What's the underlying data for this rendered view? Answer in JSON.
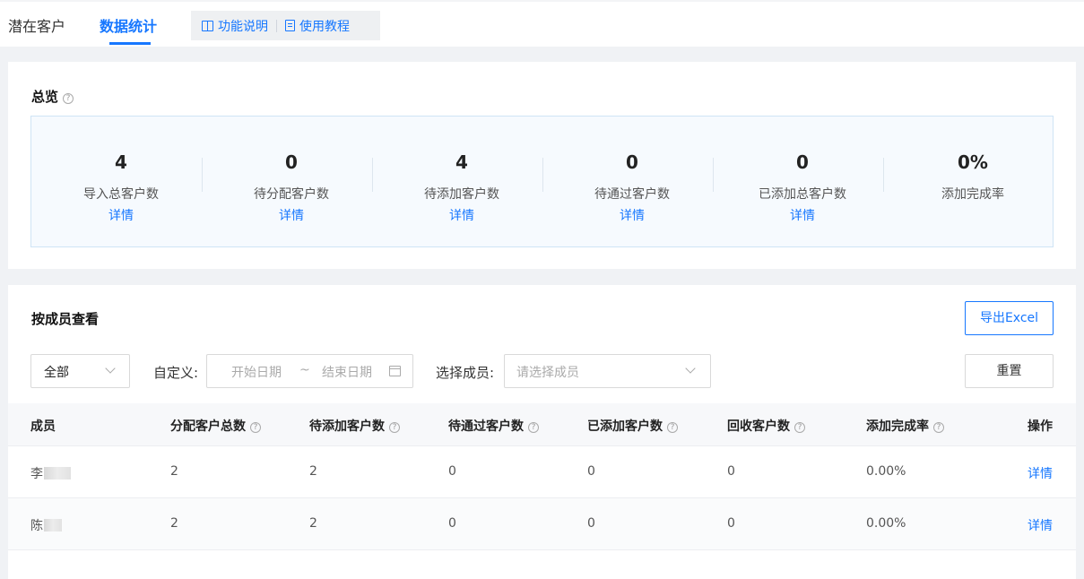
{
  "tabs": [
    {
      "label": "潜在客户"
    },
    {
      "label": "数据统计"
    }
  ],
  "tools": {
    "feature_desc": "功能说明",
    "tutorial": "使用教程"
  },
  "overview": {
    "title": "总览",
    "stats": [
      {
        "value": "4",
        "label": "导入总客户数",
        "link": "详情"
      },
      {
        "value": "0",
        "label": "待分配客户数",
        "link": "详情"
      },
      {
        "value": "4",
        "label": "待添加客户数",
        "link": "详情"
      },
      {
        "value": "0",
        "label": "待通过客户数",
        "link": "详情"
      },
      {
        "value": "0",
        "label": "已添加总客户数",
        "link": "详情"
      },
      {
        "value": "0%",
        "label": "添加完成率"
      }
    ]
  },
  "members": {
    "title": "按成员查看",
    "export_label": "导出Excel",
    "range_select": "全部",
    "custom_label": "自定义:",
    "start_placeholder": "开始日期",
    "range_sep": "~",
    "end_placeholder": "结束日期",
    "member_label": "选择成员:",
    "member_placeholder": "请选择成员",
    "reset_label": "重置",
    "columns": [
      "成员",
      "分配客户总数",
      "待添加客户数",
      "待通过客户数",
      "已添加客户数",
      "回收客户数",
      "添加完成率",
      "操作"
    ],
    "rows": [
      {
        "name": "李",
        "assigned": "2",
        "to_add": "2",
        "to_pass": "0",
        "added": "0",
        "recycled": "0",
        "rate": "0.00%",
        "action": "详情"
      },
      {
        "name": "陈",
        "assigned": "2",
        "to_add": "2",
        "to_pass": "0",
        "added": "0",
        "recycled": "0",
        "rate": "0.00%",
        "action": "详情"
      }
    ]
  }
}
